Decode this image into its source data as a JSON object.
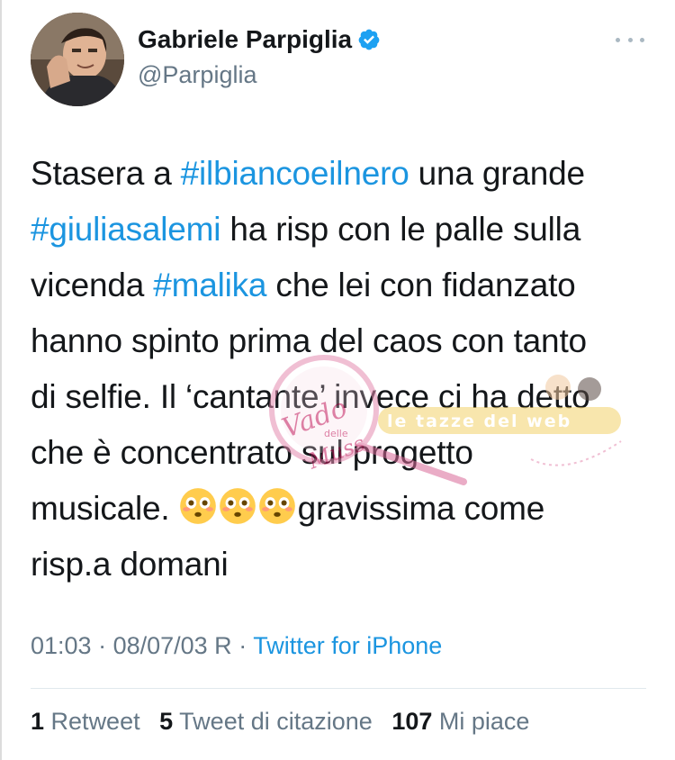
{
  "author": {
    "name": "Gabriele Parpiglia",
    "handle": "@Parpiglia"
  },
  "tweet": {
    "lines": [
      [
        {
          "t": "Stasera a ",
          "h": false
        },
        {
          "t": "#ilbiancoeilnero",
          "h": true
        },
        {
          "t": " una grande",
          "h": false
        }
      ],
      [
        {
          "t": "#giuliasalemi",
          "h": true
        },
        {
          "t": " ha risp con le palle sulla",
          "h": false
        }
      ],
      [
        {
          "t": "vicenda ",
          "h": false
        },
        {
          "t": "#malika",
          "h": true
        },
        {
          "t": " che lei con fidanzato",
          "h": false
        }
      ],
      [
        {
          "t": "hanno spinto prima del caos con tanto",
          "h": false
        }
      ],
      [
        {
          "t": "di selfie. Il ‘cantante’ invece ci ha detto",
          "h": false
        }
      ],
      [
        {
          "t": "che è concentrato sul progetto",
          "h": false
        }
      ],
      [
        {
          "t": "musicale. ",
          "h": false
        },
        {
          "emoji": "flushed-face"
        },
        {
          "emoji": "flushed-face"
        },
        {
          "emoji": "flushed-face"
        },
        {
          "t": "gravissima come",
          "h": false
        }
      ],
      [
        {
          "t": "risp.a domani",
          "h": false
        }
      ]
    ]
  },
  "meta": {
    "time": "01:03",
    "separator": " · ",
    "date": "08/07/03 R",
    "source": "Twitter for iPhone"
  },
  "stats": {
    "retweets_count": "1",
    "retweets_label": "Retweet",
    "quotes_count": "5",
    "quotes_label": "Tweet di citazione",
    "likes_count": "107",
    "likes_label": "Mi piace"
  },
  "watermark": {
    "script_text": "Vado delle Muss",
    "band_text": "le tazze del web"
  },
  "colors": {
    "link": "#1b95e0",
    "secondary": "#657786",
    "text": "#14171a",
    "divider": "#e1e8ed",
    "watermark": "#e58bb0"
  },
  "icons": {
    "verified": "verified-badge-icon",
    "more": "more-dots-icon",
    "emoji": "flushed-face-emoji"
  }
}
